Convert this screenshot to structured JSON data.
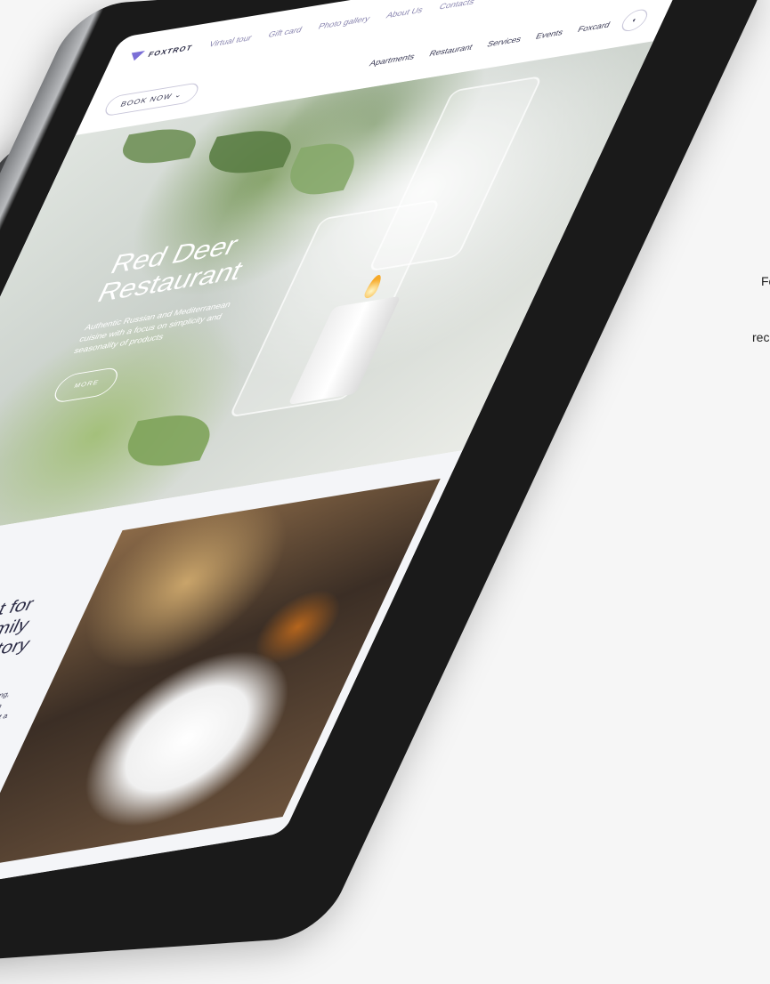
{
  "topbar": {
    "logo": "FOXTROT",
    "links": [
      "Virtual tour",
      "Gift card",
      "Photo gallery",
      "About Us",
      "Contacts"
    ],
    "social": [
      "instagram-icon",
      "facebook-icon",
      "tripadvisor-icon"
    ]
  },
  "navbar": {
    "book_label": "BOOK NOW",
    "links": [
      "Apartments",
      "Restaurant",
      "Services",
      "Events",
      "Foxcard"
    ],
    "lang": "EN"
  },
  "hero": {
    "title_line1": "Red Deer",
    "title_line2": "Restaurant",
    "subtitle": "Authentic Russian and Mediterranean cuisine with a focus on simplicity and seasonality of products",
    "more_label": "MORE"
  },
  "section": {
    "title": "Country rest for the whole family on a vast territory",
    "text": "Areas for outdoor activities, fishing, shooting, and wellness treatments. Accommodation in rooms of various categories, the ability to rent a cottage for the weekend or for the whole summer. Bar, restaurant with Russian and ... cuisine, signature delicacies, and a"
  },
  "side_text": {
    "line1": "Fo",
    "line2": "rec"
  }
}
